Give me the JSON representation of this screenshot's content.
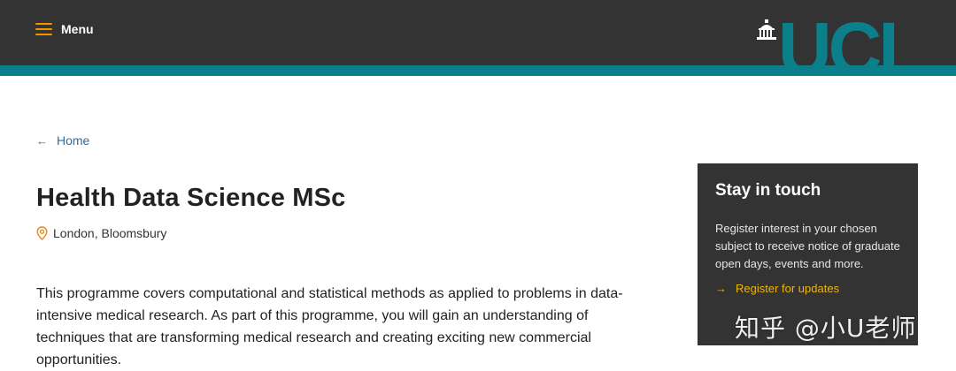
{
  "header": {
    "menu_label": "Menu",
    "logo_text": "UCL",
    "colors": {
      "bar": "#333333",
      "stripe": "#0b7f8a",
      "menu_icon": "#f29300"
    }
  },
  "breadcrumb": {
    "icon": "arrow-left-icon",
    "label": "Home"
  },
  "course": {
    "title": "Health Data Science MSc",
    "location_icon": "map-pin-icon",
    "location": "London, Bloomsbury",
    "intro": "This programme covers computational and statistical methods as applied to problems in data-intensive medical research. As part of this programme, you will gain an understanding of techniques that are transforming medical research and creating exciting new commercial opportunities."
  },
  "sidebar": {
    "title": "Stay in touch",
    "text": "Register interest in your chosen subject to receive notice of graduate open days, events and more.",
    "link_icon": "arrow-right-icon",
    "link_label": "Register for updates",
    "colors": {
      "background": "#333333",
      "link": "#f2b600"
    }
  },
  "watermark": {
    "text": "知乎 @小U老师"
  }
}
